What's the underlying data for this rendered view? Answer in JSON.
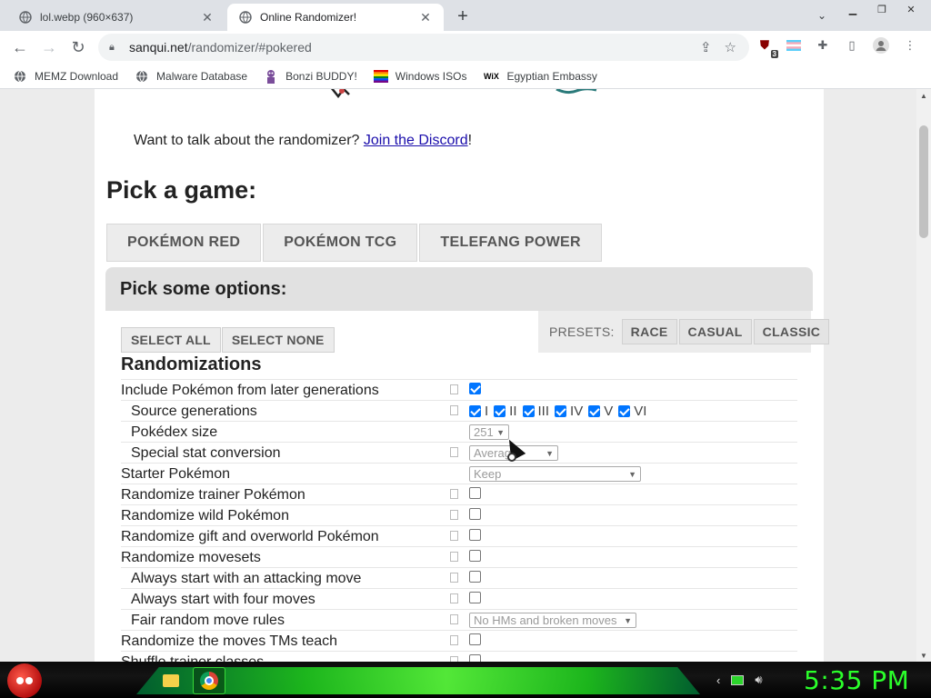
{
  "browser": {
    "tabs": [
      {
        "title": "lol.webp (960×637)",
        "active": false
      },
      {
        "title": "Online Randomizer!",
        "active": true
      }
    ],
    "url_host": "sanqui.net",
    "url_path": "/randomizer/#pokered",
    "extension_badge": "3"
  },
  "bookmarks": [
    {
      "label": "MEMZ Download",
      "icon": "globe-icon"
    },
    {
      "label": "Malware Database",
      "icon": "globe-icon"
    },
    {
      "label": "Bonzi BUDDY!",
      "icon": "bonzi-icon"
    },
    {
      "label": "Windows ISOs",
      "icon": "windows-icon"
    },
    {
      "label": "Egyptian Embassy",
      "icon": "wix-icon"
    }
  ],
  "page": {
    "discord_prefix": "Want to talk about the randomizer? ",
    "discord_link": "Join the Discord",
    "discord_suffix": "!",
    "pick_game_title": "Pick a game:",
    "game_tabs": [
      "POKÉMON RED",
      "POKÉMON TCG",
      "TELEFANG POWER"
    ],
    "options_title": "Pick some options:",
    "select_all": "SELECT ALL",
    "select_none": "SELECT NONE",
    "presets_label": "PRESETS:",
    "presets": [
      "RACE",
      "CASUAL",
      "CLASSIC"
    ],
    "section_title": "Randomizations",
    "options": [
      {
        "label": "Include Pokémon from later generations",
        "indent": false,
        "control": "checkbox",
        "checked": true
      },
      {
        "label": "Source generations",
        "indent": true,
        "control": "generations"
      },
      {
        "label": "Pokédex size",
        "indent": true,
        "control": "select",
        "value": "251"
      },
      {
        "label": "Special stat conversion",
        "indent": true,
        "control": "select",
        "value": "Average"
      },
      {
        "label": "Starter Pokémon",
        "indent": false,
        "control": "select",
        "value": "Keep"
      },
      {
        "label": "Randomize trainer Pokémon",
        "indent": false,
        "control": "checkbox",
        "checked": false
      },
      {
        "label": "Randomize wild Pokémon",
        "indent": false,
        "control": "checkbox",
        "checked": false
      },
      {
        "label": "Randomize gift and overworld Pokémon",
        "indent": false,
        "control": "checkbox",
        "checked": false
      },
      {
        "label": "Randomize movesets",
        "indent": false,
        "control": "checkbox",
        "checked": false
      },
      {
        "label": "Always start with an attacking move",
        "indent": true,
        "control": "checkbox",
        "checked": false
      },
      {
        "label": "Always start with four moves",
        "indent": true,
        "control": "checkbox",
        "checked": false
      },
      {
        "label": "Fair random move rules",
        "indent": true,
        "control": "select",
        "value": "No HMs and broken moves"
      },
      {
        "label": "Randomize the moves TMs teach",
        "indent": false,
        "control": "checkbox",
        "checked": false
      },
      {
        "label": "Shuffle trainer classes",
        "indent": false,
        "control": "checkbox",
        "checked": false
      }
    ],
    "generations": [
      "I",
      "II",
      "III",
      "IV",
      "V",
      "VI"
    ]
  },
  "taskbar": {
    "clock": "5:35 PM"
  }
}
